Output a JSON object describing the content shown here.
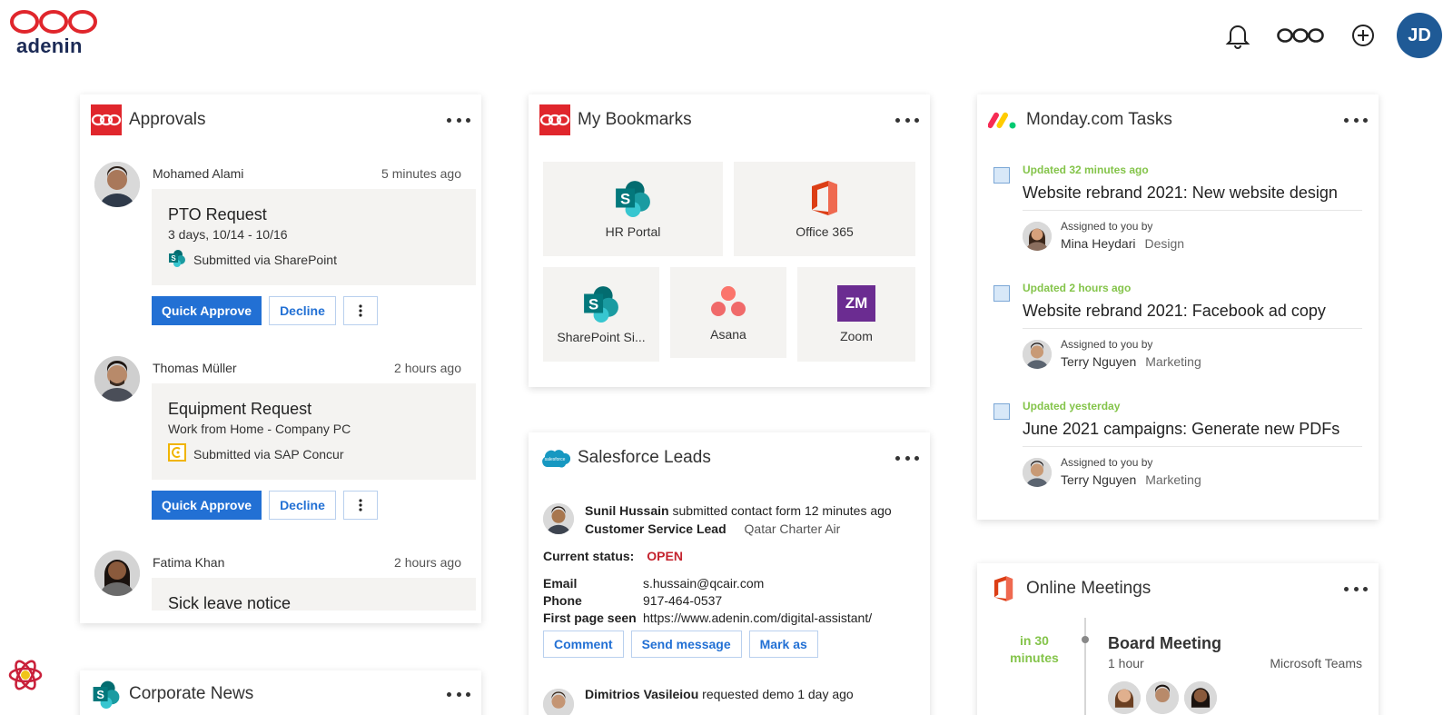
{
  "brand": {
    "logo_text": "adenin"
  },
  "header": {
    "avatar_initials": "JD"
  },
  "approvals": {
    "title": "Approvals",
    "items": [
      {
        "name": "Mohamed Alami",
        "time": "5 minutes ago",
        "request": "PTO Request",
        "detail": "3 days, 10/14 - 10/16",
        "source": "Submitted via SharePoint",
        "approve": "Quick Approve",
        "decline": "Decline"
      },
      {
        "name": "Thomas Müller",
        "time": "2 hours ago",
        "request": "Equipment Request",
        "detail": "Work from Home - Company PC",
        "source": "Submitted via SAP Concur",
        "approve": "Quick Approve",
        "decline": "Decline"
      },
      {
        "name": "Fatima Khan",
        "time": "2 hours ago",
        "request": "Sick leave notice"
      }
    ]
  },
  "bookmarks": {
    "title": "My Bookmarks",
    "tiles": [
      "HR Portal",
      "Office 365",
      "SharePoint Si...",
      "Asana",
      "Zoom"
    ],
    "zoom_badge": "ZM"
  },
  "salesforce": {
    "title": "Salesforce Leads",
    "lead1": {
      "name": "Sunil Hussain",
      "action": " submitted contact form 12 minutes ago",
      "role": "Customer Service Lead",
      "company": "Qatar Charter Air"
    },
    "status_label": "Current status:",
    "status_value": "OPEN",
    "fields": [
      {
        "key": "Email",
        "value": "s.hussain@qcair.com"
      },
      {
        "key": "Phone",
        "value": "917-464-0537"
      },
      {
        "key": "First page seen",
        "value": "https://www.adenin.com/digital-assistant/"
      }
    ],
    "actions": [
      "Comment",
      "Send message",
      "Mark as"
    ],
    "lead2": {
      "name": "Dimitrios Vasileiou",
      "action": " requested demo 1 day ago"
    }
  },
  "monday": {
    "title": "Monday.com Tasks",
    "tasks": [
      {
        "updated": "Updated 32 minutes ago",
        "title": "Website rebrand 2021: New website design",
        "assigned": "Assigned to you by",
        "person": "Mina Heydari",
        "category": "Design"
      },
      {
        "updated": "Updated 2 hours ago",
        "title": "Website rebrand 2021: Facebook ad copy",
        "assigned": "Assigned to you by",
        "person": "Terry Nguyen",
        "category": "Marketing"
      },
      {
        "updated": "Updated yesterday",
        "title": "June 2021 campaigns: Generate new PDFs",
        "assigned": "Assigned to you by",
        "person": "Terry Nguyen",
        "category": "Marketing"
      }
    ]
  },
  "meetings": {
    "title": "Online Meetings",
    "when_1": "in 30",
    "when_2": "minutes",
    "meeting": "Board Meeting",
    "duration": "1 hour",
    "platform": "Microsoft Teams"
  },
  "news": {
    "title": "Corporate News"
  },
  "colors": {
    "accent": "#2270d4",
    "open_status": "#c4232e",
    "monday_green": "#84c44a",
    "avatar_bg": "#1f5a96"
  }
}
